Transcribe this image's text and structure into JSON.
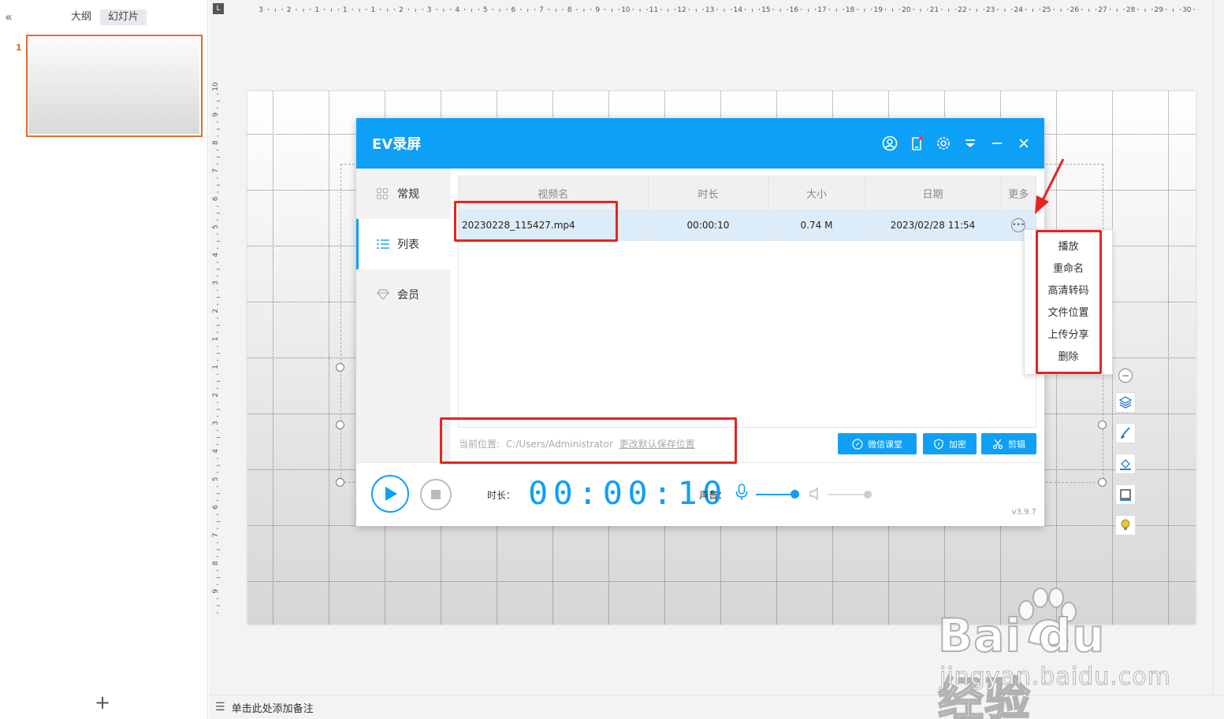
{
  "left_panel": {
    "collapse": "«",
    "tab_outline": "大纲",
    "tab_slides": "幻灯片",
    "slide_number": "1",
    "add_slide": "+"
  },
  "ruler": {
    "corner": "L",
    "h_numbers": [
      "3",
      "2",
      "1",
      "1",
      "1",
      "2",
      "3",
      "4",
      "5",
      "6",
      "7",
      "8",
      "9",
      "10",
      "11",
      "12",
      "13",
      "14",
      "15",
      "16",
      "17",
      "18",
      "19",
      "20",
      "21",
      "22",
      "23",
      "24",
      "25",
      "26",
      "27",
      "28",
      "29",
      "30"
    ],
    "v_numbers": [
      "10",
      "9",
      "8",
      "7",
      "6",
      "5",
      "4",
      "3",
      "2",
      "1",
      "1",
      "2",
      "3",
      "4",
      "5",
      "6",
      "7",
      "8",
      "9"
    ]
  },
  "notes": {
    "placeholder": "单击此处添加备注"
  },
  "ev": {
    "title": "EV录屏",
    "sidebar": [
      {
        "label": "常规",
        "icon": "grid-icon"
      },
      {
        "label": "列表",
        "icon": "list-icon"
      },
      {
        "label": "会员",
        "icon": "diamond-icon"
      }
    ],
    "table": {
      "headers": [
        "视频名",
        "时长",
        "大小",
        "日期",
        "更多"
      ],
      "rows": [
        {
          "name": "20230228_115427.mp4",
          "duration": "00:00:10",
          "size": "0.74 M",
          "date": "2023/02/28 11:54"
        }
      ]
    },
    "location_label": "当前位置:",
    "location_path": "C:/Users/Administrator",
    "location_change": "更改默认保存位置",
    "btn_wechat": "微信课堂",
    "btn_encrypt": "加密",
    "btn_cut": "剪辑",
    "duration_label": "时长：",
    "timer": "00:00:10",
    "sound_label": "声音：",
    "version": "v3.9.7"
  },
  "context_menu": [
    "播放",
    "重命名",
    "高清转码",
    "文件位置",
    "上传分享",
    "删除"
  ],
  "watermark": {
    "brand": "Bai du 经验",
    "url": "jingyan.baidu.com"
  },
  "colors": {
    "ev_blue": "#0ea0f6",
    "annotation_red": "#e52420",
    "slide_border": "#e46c29"
  }
}
